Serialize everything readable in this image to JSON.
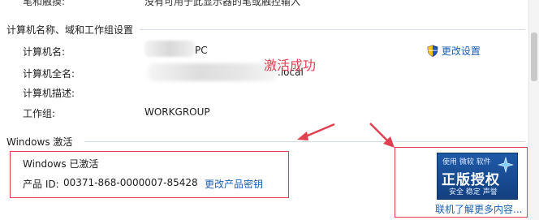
{
  "top_fragment": {
    "label": "笔和触摸:",
    "value": "没有可用于此显示器的笔或触控输入"
  },
  "computer_section": {
    "title": "计算机名称、域和工作组设置",
    "change_settings": "更改设置",
    "rows": [
      {
        "label": "计算机名:",
        "value": "PC"
      },
      {
        "label": "计算机全名:",
        "value": ".local"
      },
      {
        "label": "计算机描述:",
        "value": ""
      },
      {
        "label": "工作组:",
        "value": "WORKGROUP"
      }
    ],
    "annotation": "激活成功"
  },
  "activation_section": {
    "title": "Windows 激活",
    "status": "Windows 已激活",
    "product_id_label": "产品 ID:",
    "product_id": "00371-868-0000007-85428",
    "change_key": "更改产品密钥",
    "badge_top": "使用 微软 软件",
    "badge_main": "正版授权",
    "badge_sub": "安全 稳定 声誉",
    "learn_more": "联机了解更多内容..."
  },
  "colors": {
    "accent_link": "#1a5fb4",
    "annotation_red": "#e04050"
  }
}
